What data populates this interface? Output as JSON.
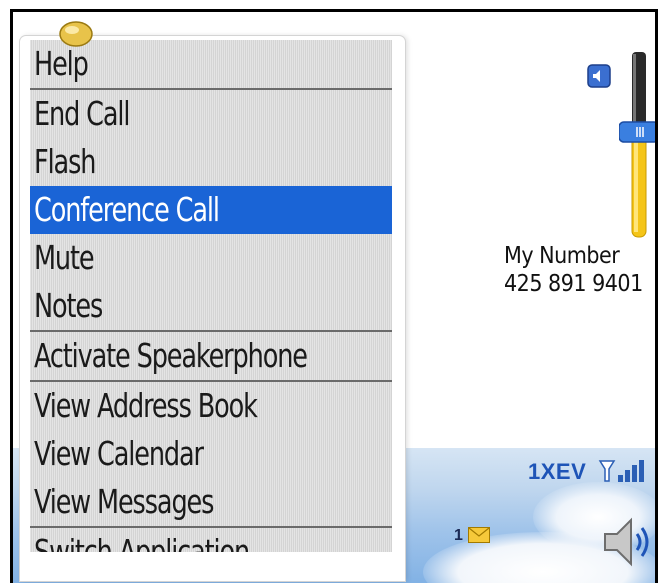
{
  "menu": {
    "items": [
      {
        "label": "Help"
      },
      {
        "label": "End Call"
      },
      {
        "label": "Flash"
      },
      {
        "label": "Conference Call",
        "selected": true
      },
      {
        "label": "Mute"
      },
      {
        "label": "Notes"
      },
      {
        "label": "Activate Speakerphone"
      },
      {
        "label": "View Address Book"
      },
      {
        "label": "View Calendar"
      },
      {
        "label": "View Messages"
      },
      {
        "label": "Switch Application"
      }
    ]
  },
  "phone": {
    "my_number_label": "My Number",
    "my_number": "425 891 9401",
    "network": "1XEV",
    "message_count": "1",
    "icons": [
      "volume-icon",
      "volume-slider",
      "signal-icon",
      "envelope-icon",
      "speaker-icon",
      "pencil-icon"
    ]
  },
  "colors": {
    "selection": "#1a64d6",
    "network_text": "#1e54b7",
    "slider_fill": "#f5c518"
  }
}
